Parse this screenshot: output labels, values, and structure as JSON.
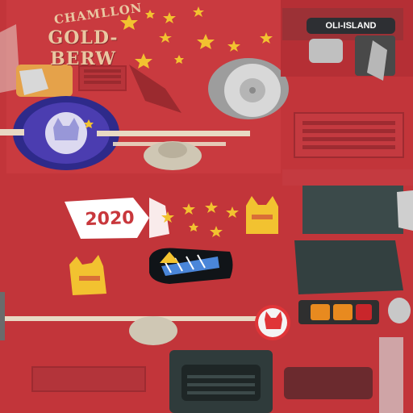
{
  "texture": {
    "brand_arc_text": "CHAMLLON",
    "brand_main_text": "GOLD-BERW",
    "island_label": "OLI-ISLAND",
    "year_label": "2020"
  },
  "colors": {
    "base_red": "#c8373c",
    "dark_red": "#a82c31",
    "gold": "#f2c230",
    "cream": "#e9c8a2",
    "grey": "#b8b8b8",
    "dark_slate": "#3a4a4a",
    "purple": "#3a2a8a"
  },
  "icons": [
    "cat-face-icon",
    "star-icon",
    "wheel-icon",
    "cat-sticker-icon",
    "tail-light-icon"
  ]
}
